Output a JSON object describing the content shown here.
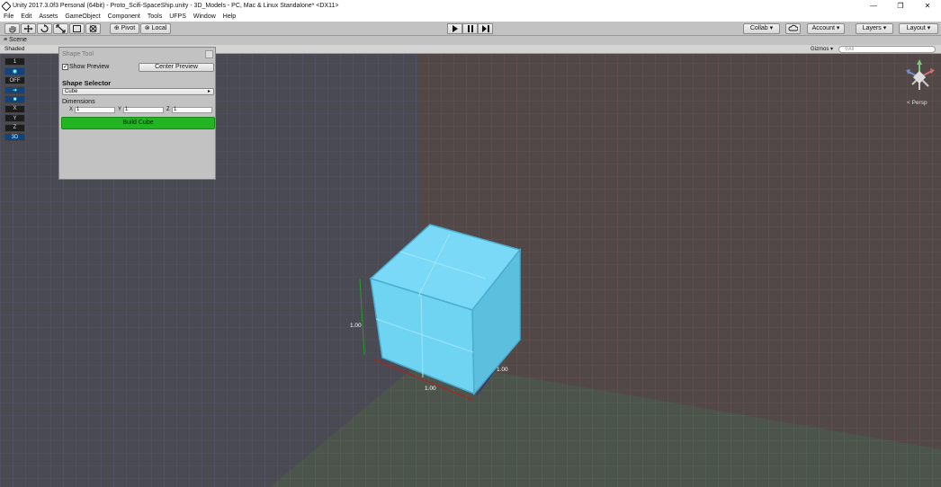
{
  "window": {
    "title": "Unity 2017.3.0f3 Personal (64bit) - Proto_Scifi-SpaceShip.unity - 3D_Models - PC, Mac & Linux Standalone* <DX11>",
    "controls": [
      "—",
      "❐",
      "✕"
    ]
  },
  "menu": [
    "File",
    "Edit",
    "Assets",
    "GameObject",
    "Component",
    "Tools",
    "UFPS",
    "Window",
    "Help"
  ],
  "toolbar": {
    "pivot": "Pivot",
    "local": "Local",
    "collab": "Collab ▾",
    "account": "Account ▾",
    "layers": "Layers",
    "layout": "Layout"
  },
  "scene": {
    "tab": "Scene",
    "shading": "Shaded",
    "gizmos": "Gizmos ▾",
    "search_placeholder": "All",
    "persp": "< Persp",
    "dim_x": "1.00",
    "dim_y": "1.00",
    "dim_z": "1.00"
  },
  "sidetools": [
    "1",
    "",
    "OFF",
    "",
    "",
    "X",
    "Y",
    "Z",
    "3D"
  ],
  "panel": {
    "title": "Shape Tool",
    "show_preview": "Show Preview",
    "center_preview": "Center Preview",
    "shape_selector": "Shape Selector",
    "shape": "Cube",
    "dimensions": "Dimensions",
    "x_label": "X",
    "x": "1",
    "y_label": "Y",
    "y": "1",
    "z_label": "Z",
    "z": "1",
    "build": "Build Cube"
  }
}
